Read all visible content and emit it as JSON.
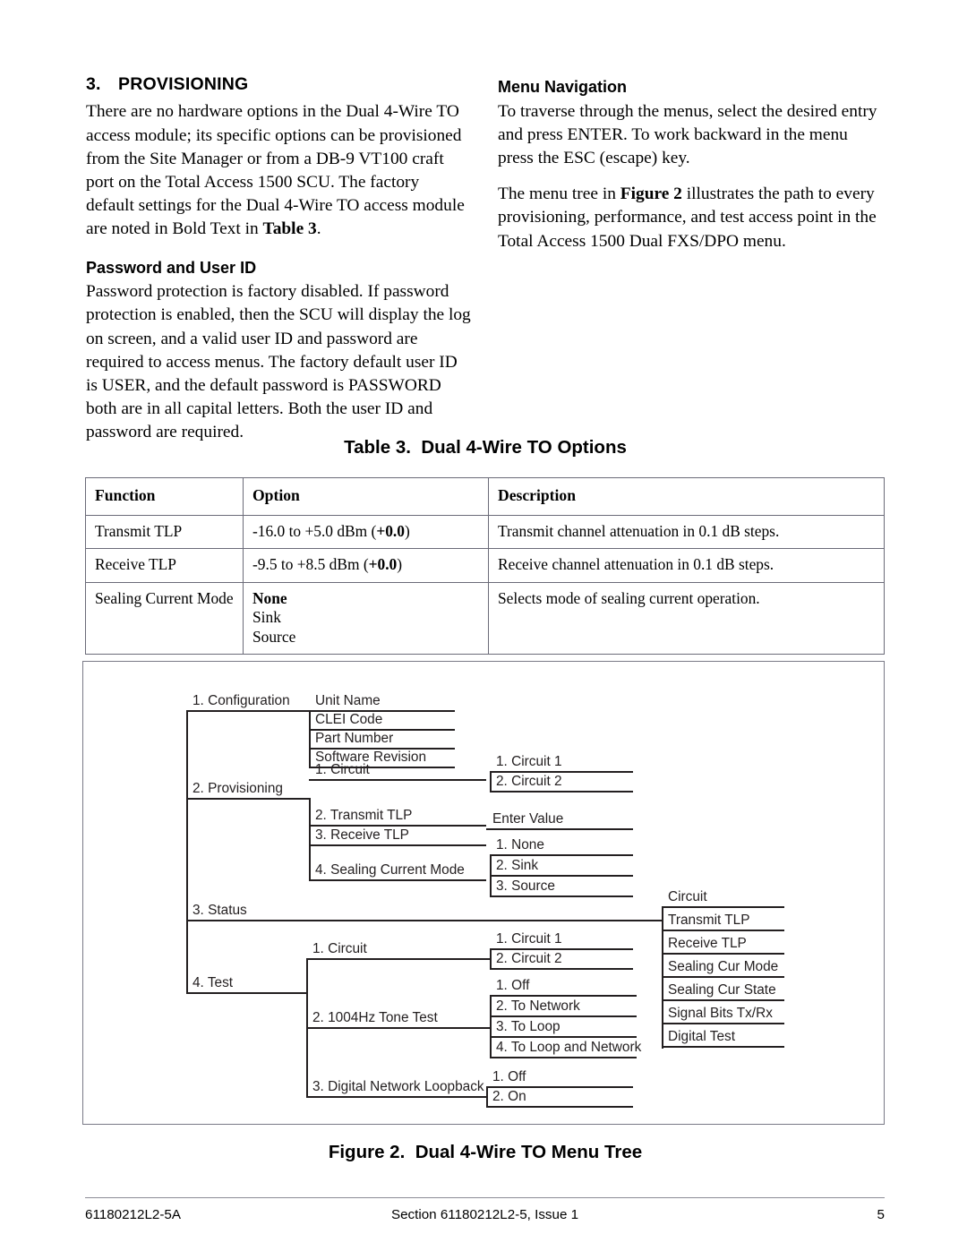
{
  "left_column": {
    "section_number": "3.",
    "section_title": "PROVISIONING",
    "intro_p1_a": "There are no hardware options in the Dual 4-Wire TO access module; its specific options can be provisioned from the Site Manager or from a DB-9 VT100 craft port on the Total Access 1500 SCU.  The factory default settings for the Dual 4-Wire TO access module are noted in Bold Text in ",
    "intro_p1_bold": "Table 3",
    "intro_p1_b": ".",
    "password_heading": "Password and User ID",
    "password_body": "Password protection is factory disabled.  If password protection is enabled, then the SCU will display the log on screen, and a valid user ID and password are required to access menus. The factory default user ID is USER, and the default password is PASSWORD both are in all capital letters.  Both the user ID and password are required."
  },
  "right_column": {
    "menu_nav_heading": "Menu Navigation",
    "menu_nav_p1": "To traverse through the menus, select the desired entry and press ENTER. To work backward in the menu press the ESC (escape) key.",
    "menu_nav_p2_a": "The menu tree in ",
    "menu_nav_p2_bold": "Figure 2",
    "menu_nav_p2_b": " illustrates the path to every provisioning, performance, and test access point in the Total Access 1500 Dual FXS/DPO menu."
  },
  "table": {
    "caption_label": "Table 3.",
    "caption_title": "Dual 4-Wire TO Options",
    "headers": [
      "Function",
      "Option",
      "Description"
    ],
    "rows": [
      {
        "function": "Transmit TLP",
        "option_plain": "-16.0 to +5.0 dBm (",
        "option_bold": "+0.0",
        "option_tail": ")",
        "description": "Transmit channel attenuation in 0.1 dB steps."
      },
      {
        "function": "Receive TLP",
        "option_plain": "-9.5 to +8.5 dBm (",
        "option_bold": "+0.0",
        "option_tail": ")",
        "description": "Receive channel attenuation in 0.1 dB steps."
      },
      {
        "function": "Sealing Current Mode",
        "option_bold": "None",
        "option_line2": "Sink",
        "option_line3": "Source",
        "description": "Selects mode of sealing current operation."
      }
    ]
  },
  "figure": {
    "caption_label": "Figure 2.",
    "caption_title": "Dual 4-Wire TO Menu Tree",
    "tree": {
      "level1": [
        {
          "id": "configuration",
          "label": "1. Configuration"
        },
        {
          "id": "provisioning",
          "label": "2. Provisioning"
        },
        {
          "id": "status",
          "label": "3. Status"
        },
        {
          "id": "test",
          "label": "4. Test"
        }
      ],
      "configuration_children": [
        "Unit Name",
        "CLEI Code",
        "Part Number",
        "Software Revision"
      ],
      "provisioning_children": [
        "1. Circuit",
        "2. Transmit TLP",
        "3. Receive TLP",
        "4. Sealing Current Mode"
      ],
      "provisioning_circuit_children": [
        "1. Circuit 1",
        "2. Circuit 2"
      ],
      "tlp_child": "Enter Value",
      "sealing_current_children": [
        "1. None",
        "2. Sink",
        "3. Source"
      ],
      "status_children": [
        "Circuit",
        "Transmit TLP",
        "Receive TLP",
        "Sealing Cur Mode",
        "Sealing Cur State",
        "Signal Bits Tx/Rx",
        "Digital Test"
      ],
      "test_children": [
        "1. Circuit",
        "2. 1004Hz Tone Test",
        "3. Digital Network Loopback"
      ],
      "test_circuit_children": [
        "1. Circuit 1",
        "2. Circuit 2"
      ],
      "tone_test_children": [
        "1. Off",
        "2. To Network",
        "3. To Loop",
        "4. To Loop and Network"
      ],
      "loopback_children": [
        "1. Off",
        "2. On"
      ]
    }
  },
  "footer": {
    "left": "61180212L2-5A",
    "center": "Section 61180212L2-5, Issue 1",
    "right": "5"
  }
}
